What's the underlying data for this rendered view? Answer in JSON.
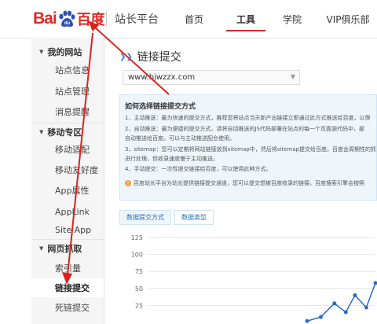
{
  "header": {
    "logo_bai": "Bai",
    "logo_du": "百度",
    "site_title": "站长平台",
    "nav": [
      "首页",
      "工具",
      "学院",
      "VIP俱乐部"
    ],
    "active_nav": "工具"
  },
  "sidebar": {
    "sections": [
      {
        "title": "我的网站",
        "items": [
          "站点信息",
          "站点管理",
          "消息提醒"
        ]
      },
      {
        "title": "移动专区",
        "items": [
          "移动适配",
          "移动友好度",
          "App属性",
          "AppLink",
          "Site App"
        ]
      },
      {
        "title": "网页抓取",
        "items": [
          "索引量",
          "链接提交",
          "死链提交"
        ]
      }
    ],
    "active_item": "链接提交"
  },
  "main": {
    "title": "链接提交",
    "site_select_value": "www.bjwzzx.com",
    "info": {
      "heading": "如何选择链接提交方式",
      "lines": [
        "1、主动推送：最为快速的提交方式，推荐您将站点当天新产出链接立即通过此方式推送给百度，以保",
        "2、自动推送：最为便捷的提交方式，请将自动推送的JS代码部署在站点的每一个页面源代码中，部",
        "自动推送给百度。可以与主动推送配合使用。",
        "3、sitemap：您可以定期将网站链接放到sitemap中，然后将sitemap提交给百度。百度会周期性的抓",
        "进行处理，但收录速度慢于主动推送。",
        "4、手动提交：一次性提交链接给百度，可以使用此种方式。"
      ],
      "notice": "百度站长平台为站长提供链接提交通道，您可以提交想被百度收录的链接，百度搜索引擎会按照"
    },
    "tabs": [
      "数据提交方式",
      "数据类型"
    ],
    "active_tab": "数据提交方式"
  },
  "chart_data": {
    "type": "line",
    "y_ticks": [
      "125",
      "100",
      "75",
      "50",
      "25"
    ],
    "ylim": [
      0,
      125
    ],
    "grid": true,
    "series": [
      {
        "values": [
          {
            "x": 0.7,
            "y": 2
          },
          {
            "x": 0.76,
            "y": 8
          },
          {
            "x": 0.82,
            "y": 28
          },
          {
            "x": 0.87,
            "y": 15
          },
          {
            "x": 0.91,
            "y": 40
          },
          {
            "x": 0.96,
            "y": 22
          },
          {
            "x": 1.0,
            "y": 58
          }
        ]
      }
    ],
    "line_color": "#2b6cc4"
  },
  "colors": {
    "brand_red": "#de2b27",
    "accent_blue": "#2b6cc4"
  }
}
